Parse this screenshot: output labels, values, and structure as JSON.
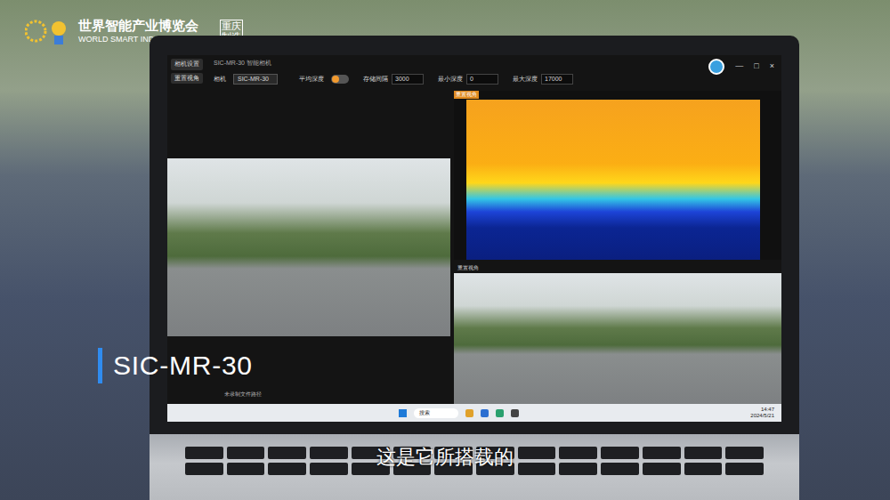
{
  "overlay": {
    "expo_name": "世界智能产业博览会",
    "expo_name_en": "WORLD SMART INDUSTRY EXPO",
    "stamp": "重庆制造",
    "product_caption": "SIC-MR-30",
    "subtitle": "这是它所搭载的"
  },
  "app": {
    "title": "SIC-MR-30 智能相机",
    "side_buttons": [
      "相机设置",
      "重置视角"
    ],
    "camera_label": "相机",
    "camera_value": "SIC-MR-30",
    "average_depth": {
      "label": "平均深度",
      "on": true
    },
    "fields": [
      {
        "label": "存储间隔",
        "value": "3000"
      },
      {
        "label": "最小深度",
        "value": "0"
      },
      {
        "label": "最大深度",
        "value": "17000"
      }
    ],
    "window_controls": [
      "—",
      "□",
      "×"
    ],
    "panels": {
      "depth_tag": "重置视角",
      "camera_tag": "重置视角",
      "left_note": "未录制文件路径"
    }
  },
  "taskbar": {
    "search": "搜索",
    "time": "14:47",
    "date": "2024/5/21"
  }
}
